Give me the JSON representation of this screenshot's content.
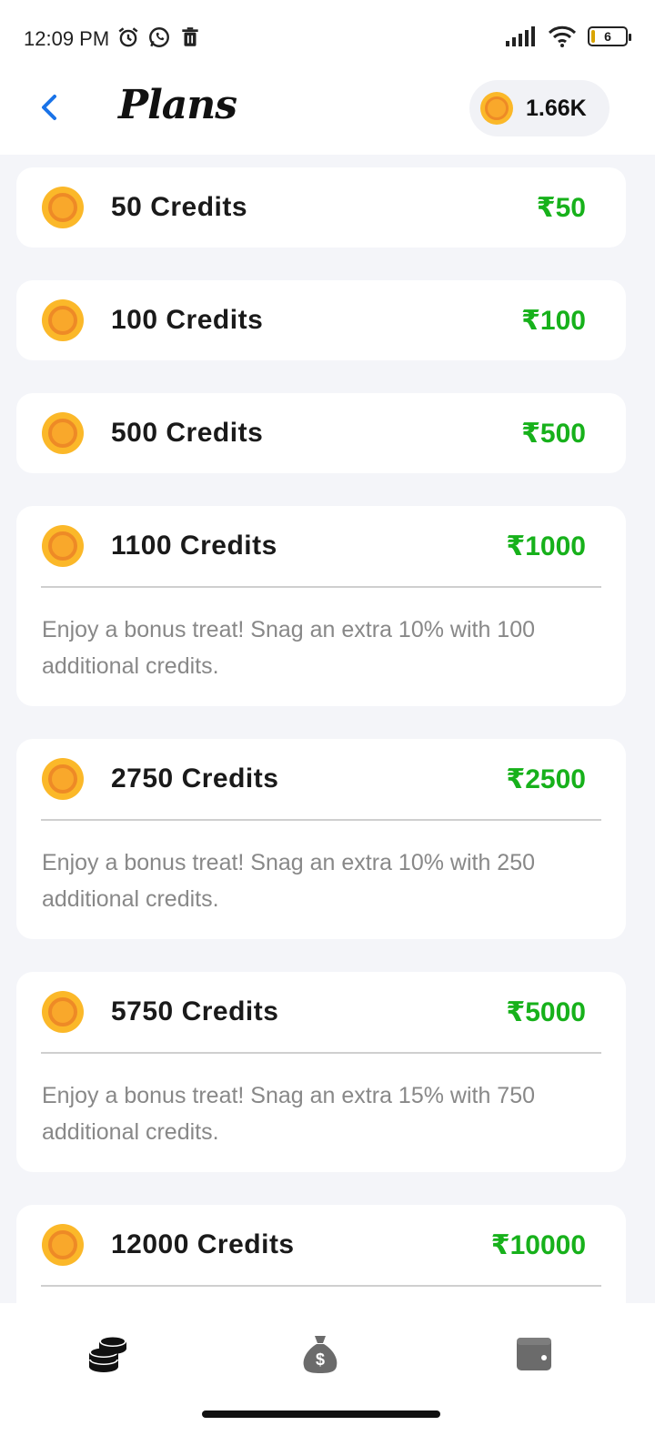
{
  "status_bar": {
    "time": "12:09 PM",
    "battery": "6"
  },
  "header": {
    "title": "Plans",
    "balance": "1.66K"
  },
  "plans": [
    {
      "credits": "50 Credits",
      "price": "₹50"
    },
    {
      "credits": "100 Credits",
      "price": "₹100"
    },
    {
      "credits": "500 Credits",
      "price": "₹500"
    },
    {
      "credits": "1100 Credits",
      "price": "₹1000",
      "desc": "Enjoy a bonus treat! Snag an extra 10% with 100 additional credits."
    },
    {
      "credits": "2750 Credits",
      "price": "₹2500",
      "desc": "Enjoy a bonus treat! Snag an extra 10% with 250 additional credits."
    },
    {
      "credits": "5750 Credits",
      "price": "₹5000",
      "desc": "Enjoy a bonus treat! Snag an extra 15% with 750 additional credits."
    },
    {
      "credits": "12000 Credits",
      "price": "₹10000"
    }
  ],
  "nav": [
    {
      "icon": "coins-stack-icon",
      "active": true
    },
    {
      "icon": "money-bag-icon",
      "active": false
    },
    {
      "icon": "wallet-icon",
      "active": false
    }
  ],
  "colors": {
    "price": "#17b11b",
    "accent": "#1a73e8",
    "coin": "#fbb829"
  }
}
